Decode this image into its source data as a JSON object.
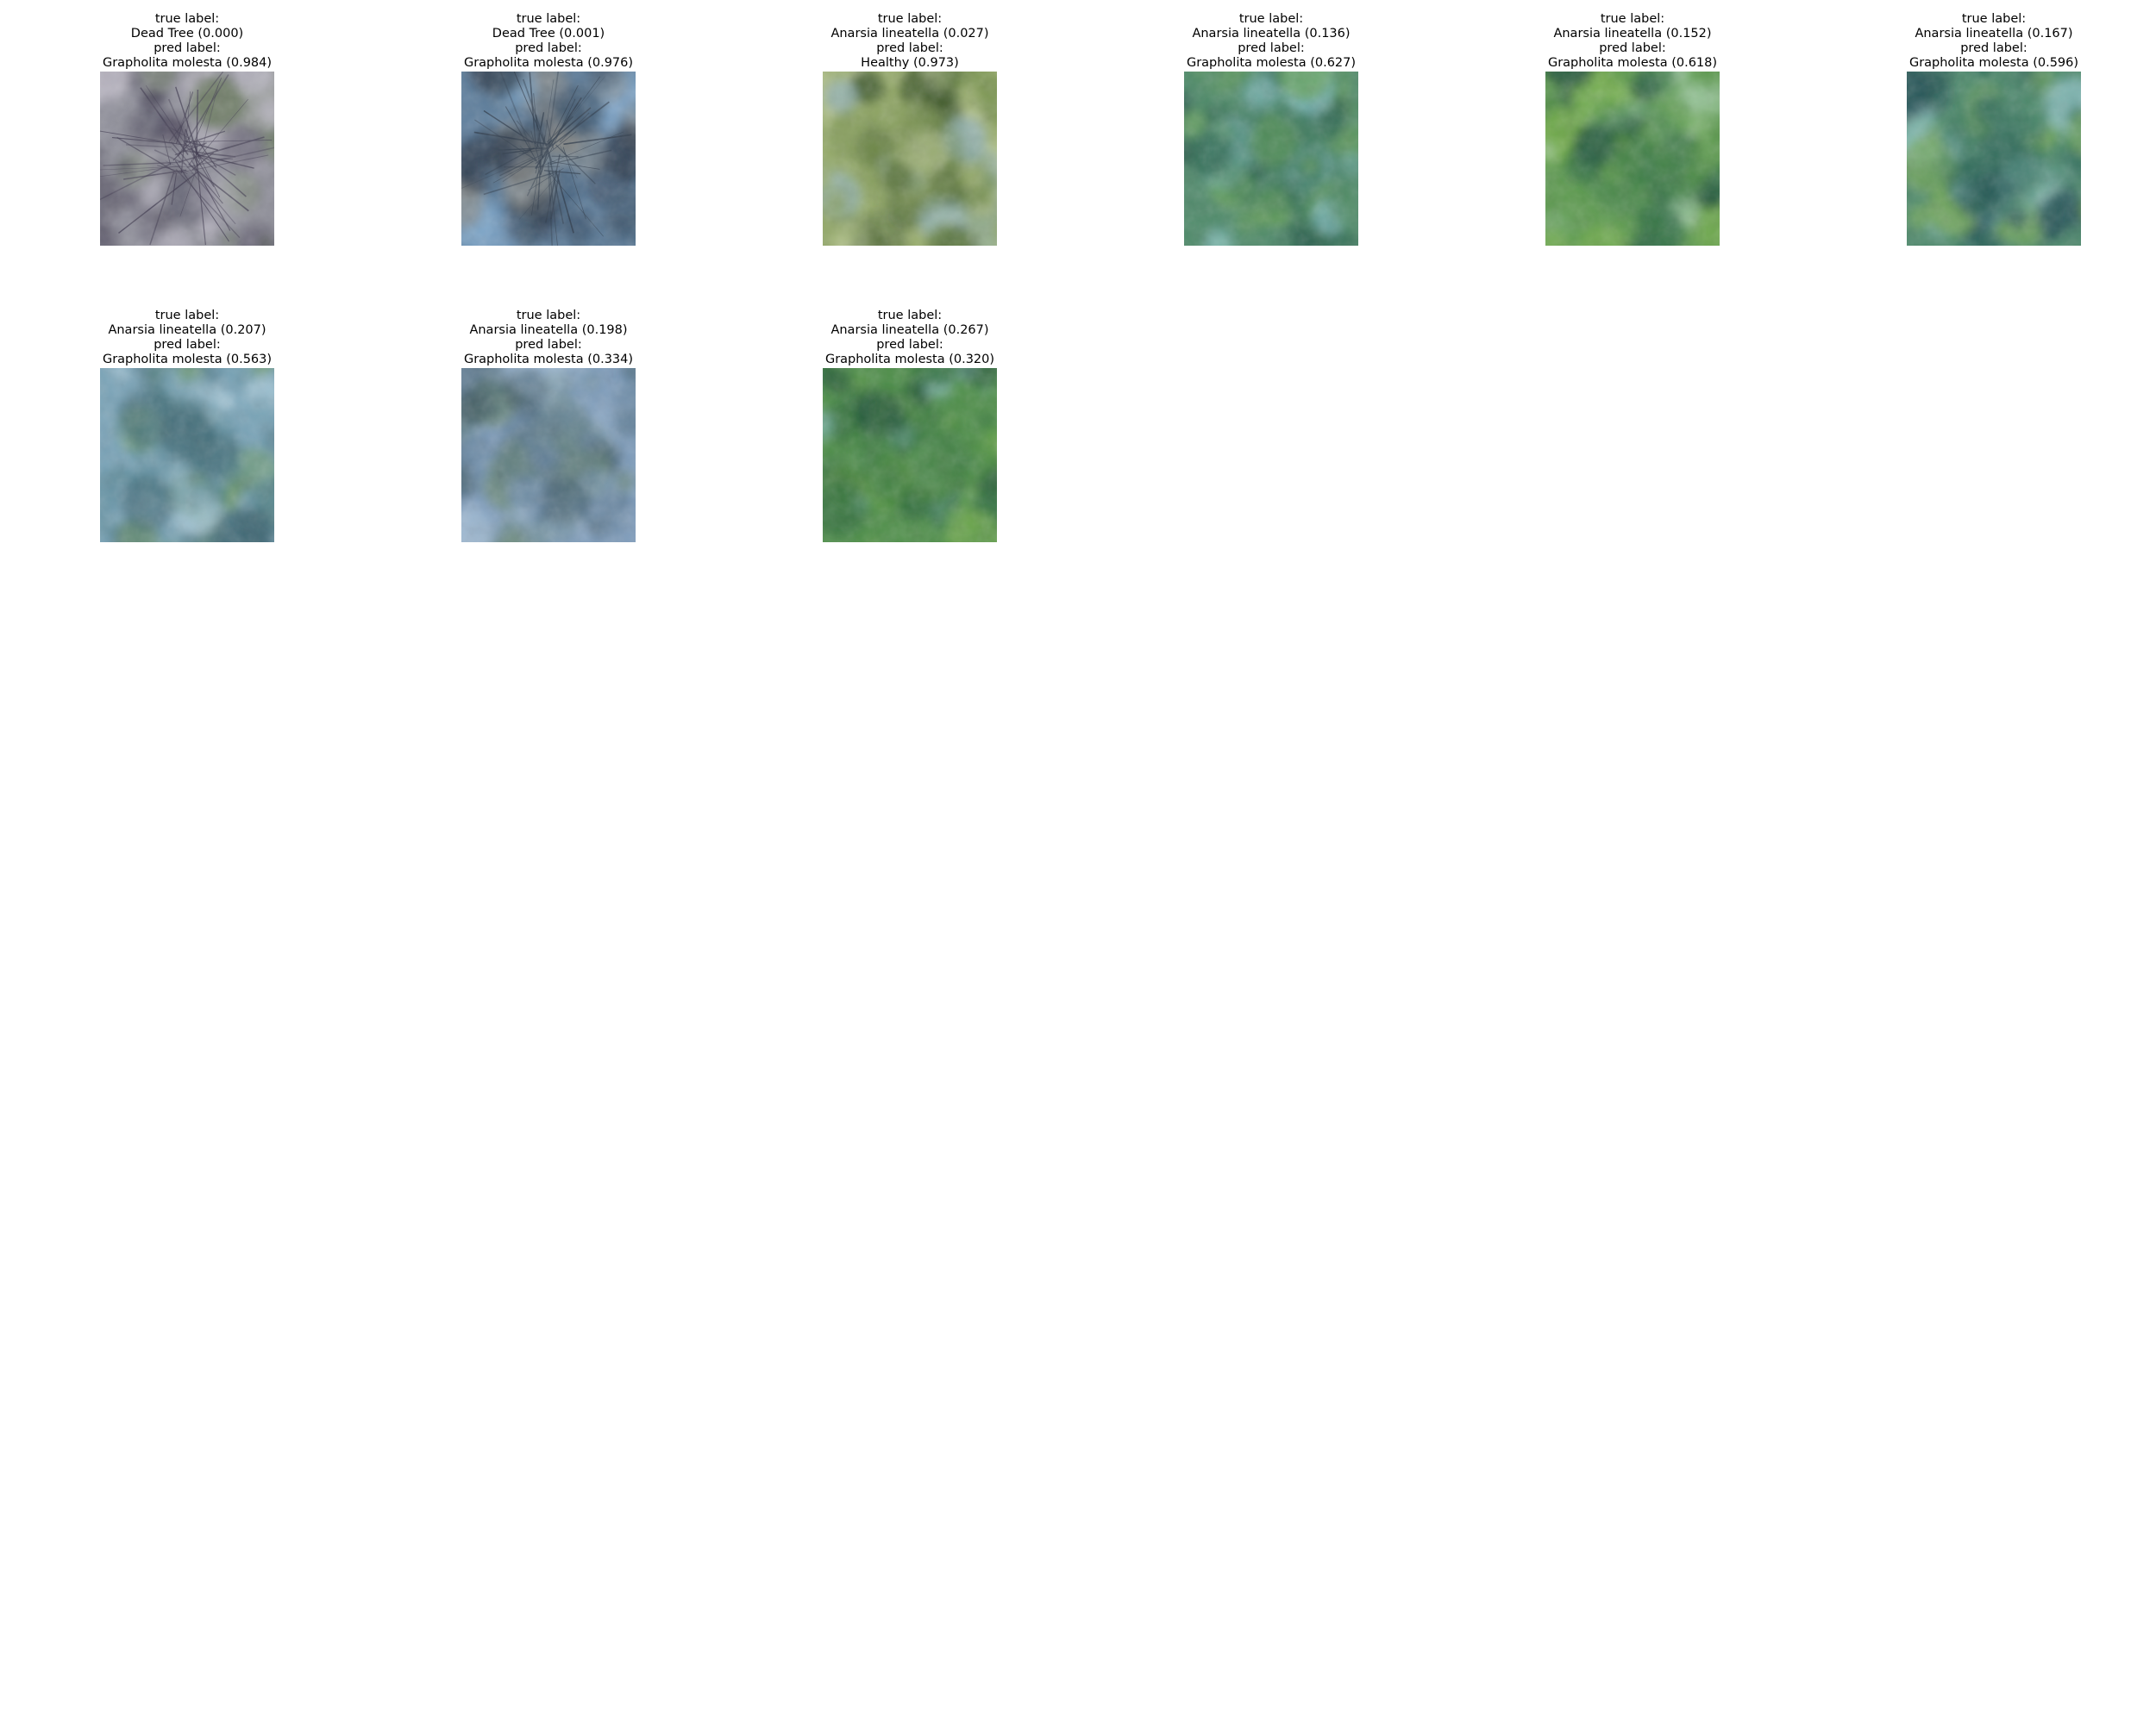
{
  "figure": {
    "tiles": [
      {
        "true_heading": "true label:",
        "true_value": "Dead Tree (0.000)",
        "pred_heading": "pred label:",
        "pred_value": "Grapholita molesta (0.984)",
        "palette": [
          "#8f8f9a",
          "#5d5a6a",
          "#6f7d66",
          "#b9b6c2",
          "#3f3a4f"
        ],
        "texture": "dead"
      },
      {
        "true_heading": "true label:",
        "true_value": "Dead Tree (0.001)",
        "pred_heading": "pred label:",
        "pred_value": "Grapholita molesta (0.976)",
        "palette": [
          "#5f7f9d",
          "#3e566e",
          "#7ea7cc",
          "#8a8a86",
          "#2d3a4a"
        ],
        "texture": "dead"
      },
      {
        "true_heading": "true label:",
        "true_value": "Anarsia lineatella (0.027)",
        "pred_heading": "pred label:",
        "pred_value": "Healthy (0.973)",
        "palette": [
          "#98ad6c",
          "#6f8a48",
          "#c5d0a3",
          "#8fb0b6",
          "#3f5a2c"
        ],
        "texture": "canopy"
      },
      {
        "true_heading": "true label:",
        "true_value": "Anarsia lineatella (0.136)",
        "pred_heading": "pred label:",
        "pred_value": "Grapholita molesta (0.627)",
        "palette": [
          "#4f8a6a",
          "#2f6a52",
          "#86c0c8",
          "#6aa45a",
          "#1f4f46"
        ],
        "texture": "canopy"
      },
      {
        "true_heading": "true label:",
        "true_value": "Anarsia lineatella (0.152)",
        "pred_heading": "pred label:",
        "pred_value": "Grapholita molesta (0.618)",
        "palette": [
          "#5d9a4f",
          "#2f6e46",
          "#9cc8a0",
          "#78b04c",
          "#1d4d3a"
        ],
        "texture": "canopy"
      },
      {
        "true_heading": "true label:",
        "true_value": "Anarsia lineatella (0.167)",
        "pred_heading": "pred label:",
        "pred_value": "Grapholita molesta (0.596)",
        "palette": [
          "#4e8a6c",
          "#2e6a5a",
          "#8bbfc2",
          "#75a85a",
          "#235055"
        ],
        "texture": "canopy"
      },
      {
        "true_heading": "true label:",
        "true_value": "Anarsia lineatella (0.207)",
        "pred_heading": "pred label:",
        "pred_value": "Grapholita molesta (0.563)",
        "palette": [
          "#7aa4b8",
          "#4f7f8a",
          "#a9c9d8",
          "#6f9a62",
          "#3d6470"
        ],
        "texture": "canopy"
      },
      {
        "true_heading": "true label:",
        "true_value": "Anarsia lineatella (0.198)",
        "pred_heading": "pred label:",
        "pred_value": "Grapholita molesta (0.334)",
        "palette": [
          "#7f9dbc",
          "#56738a",
          "#a5bfd8",
          "#6c8a7a",
          "#3a5560"
        ],
        "texture": "canopy"
      },
      {
        "true_heading": "true label:",
        "true_value": "Anarsia lineatella (0.267)",
        "pred_heading": "pred label:",
        "pred_value": "Grapholita molesta (0.320)",
        "palette": [
          "#4f8f4a",
          "#2f6c3c",
          "#8cc0c8",
          "#6faa48",
          "#1f4d3a"
        ],
        "texture": "canopy"
      }
    ]
  }
}
